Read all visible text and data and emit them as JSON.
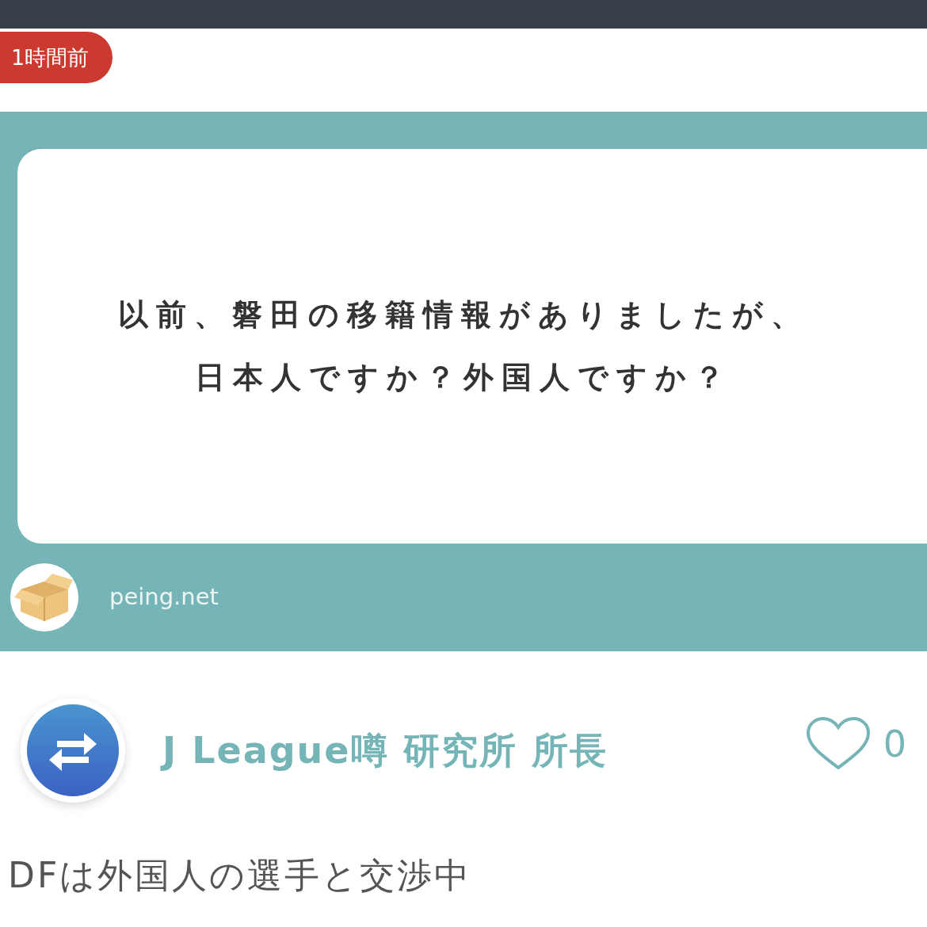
{
  "time_badge": "1時間前",
  "question_card": {
    "lines": [
      "以前、磐田の移籍情報がありましたが、",
      "日本人ですか？外国人ですか？"
    ],
    "site": "peing.net"
  },
  "answer": {
    "author": "J League噂 研究所 所長",
    "liked": false,
    "likes": "0",
    "text": "DFは外国人の選手と交渉中"
  }
}
